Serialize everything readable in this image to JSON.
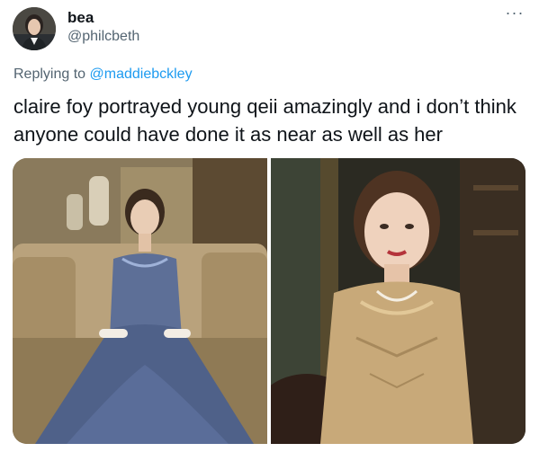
{
  "tweet": {
    "author": {
      "display_name": "bea",
      "handle": "@philcbeth",
      "avatar_icon": "person-portrait-avatar"
    },
    "more_icon": "more-horizontal-icon",
    "more_glyph": "···",
    "reply": {
      "prefix": "Replying to ",
      "mention": "@maddiebckley"
    },
    "text": "claire foy portrayed young qeii amazingly and i don’t think anyone could have done it as near as well as her",
    "media": [
      {
        "icon": "photo-woman-blue-gown-on-sofa"
      },
      {
        "icon": "photo-woman-gold-dress-portrait"
      }
    ]
  },
  "colors": {
    "text": "#0f1419",
    "secondary": "#536471",
    "link": "#1d9bf0",
    "background": "#ffffff"
  }
}
